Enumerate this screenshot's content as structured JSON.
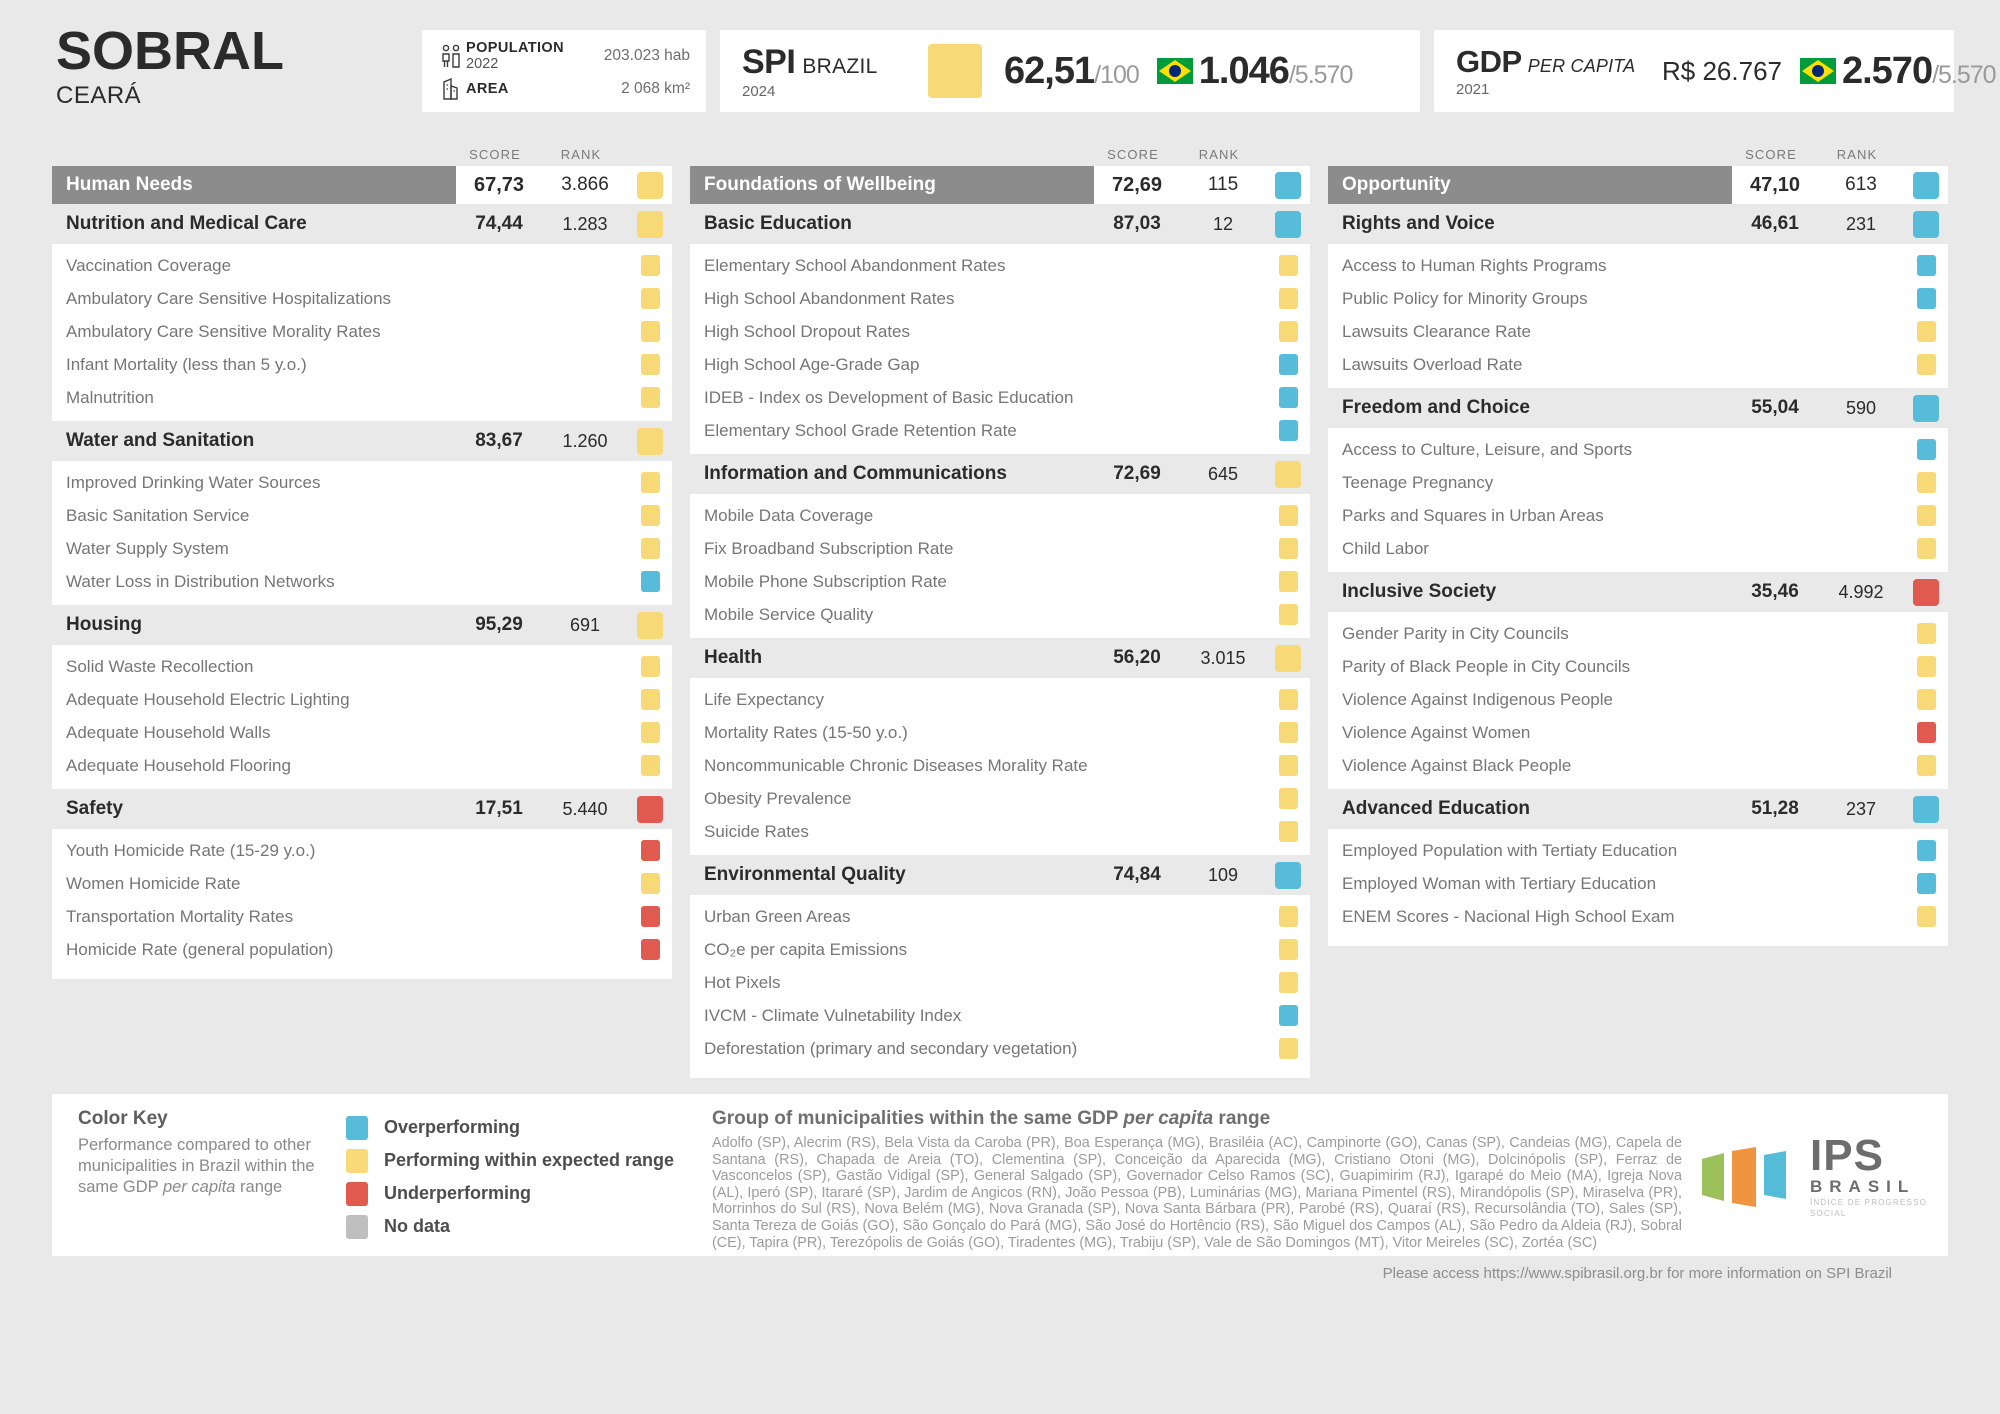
{
  "header": {
    "city": "SOBRAL",
    "state": "CEARÁ",
    "population": {
      "label": "POPULATION",
      "year": "2022",
      "value": "203.023 hab",
      "icon": "people-icon"
    },
    "area": {
      "label": "AREA",
      "value": "2 068 km²",
      "icon": "building-icon"
    },
    "spi": {
      "title": "SPI",
      "country": "BRAZIL",
      "year": "2024",
      "swatch_color": "#f8d978",
      "score": "62,51",
      "score_denominator": "/100",
      "rank": "1.046",
      "rank_denominator": "/5.570",
      "flag": "brazil-flag-icon"
    },
    "gdp": {
      "title": "GDP",
      "subtitle": "PER CAPITA",
      "year": "2021",
      "value": "R$ 26.767",
      "rank": "2.570",
      "rank_denominator": "/5.570",
      "flag": "brazil-flag-icon"
    }
  },
  "table_headers": {
    "score": "SCORE",
    "rank": "RANK"
  },
  "colors": {
    "over": "#56bcd9",
    "within": "#f8d978",
    "under": "#e05a4f",
    "nodata": "#bfbfbf",
    "dimension_bar": "#8c8c8c"
  },
  "columns": [
    {
      "dimension": {
        "name": "Human Needs",
        "score": "67,73",
        "rank": "3.866",
        "status": "within"
      },
      "components": [
        {
          "name": "Nutrition and Medical Care",
          "score": "74,44",
          "rank": "1.283",
          "status": "within",
          "indicators": [
            {
              "name": "Vaccination Coverage",
              "status": "within"
            },
            {
              "name": "Ambulatory Care Sensitive Hospitalizations",
              "status": "within"
            },
            {
              "name": "Ambulatory Care Sensitive Morality Rates",
              "status": "within"
            },
            {
              "name": "Infant Mortality (less than 5 y.o.)",
              "status": "within"
            },
            {
              "name": "Malnutrition",
              "status": "within"
            }
          ]
        },
        {
          "name": "Water and Sanitation",
          "score": "83,67",
          "rank": "1.260",
          "status": "within",
          "indicators": [
            {
              "name": "Improved Drinking Water Sources",
              "status": "within"
            },
            {
              "name": "Basic Sanitation Service",
              "status": "within"
            },
            {
              "name": "Water Supply System",
              "status": "within"
            },
            {
              "name": "Water Loss in Distribution Networks",
              "status": "over"
            }
          ]
        },
        {
          "name": "Housing",
          "score": "95,29",
          "rank": "691",
          "status": "within",
          "indicators": [
            {
              "name": "Solid Waste Recollection",
              "status": "within"
            },
            {
              "name": "Adequate Household Electric Lighting",
              "status": "within"
            },
            {
              "name": "Adequate Household Walls",
              "status": "within"
            },
            {
              "name": "Adequate Household Flooring",
              "status": "within"
            }
          ]
        },
        {
          "name": "Safety",
          "score": "17,51",
          "rank": "5.440",
          "status": "under",
          "indicators": [
            {
              "name": "Youth Homicide Rate (15-29 y.o.)",
              "status": "under"
            },
            {
              "name": "Women Homicide Rate",
              "status": "within"
            },
            {
              "name": "Transportation Mortality Rates",
              "status": "under"
            },
            {
              "name": "Homicide Rate (general population)",
              "status": "under"
            }
          ]
        }
      ]
    },
    {
      "dimension": {
        "name": "Foundations of Wellbeing",
        "score": "72,69",
        "rank": "115",
        "status": "over"
      },
      "components": [
        {
          "name": "Basic Education",
          "score": "87,03",
          "rank": "12",
          "status": "over",
          "indicators": [
            {
              "name": "Elementary School Abandonment Rates",
              "status": "within"
            },
            {
              "name": "High School Abandonment Rates",
              "status": "within"
            },
            {
              "name": "High School Dropout Rates",
              "status": "within"
            },
            {
              "name": "High School Age-Grade Gap",
              "status": "over"
            },
            {
              "name": "IDEB - Index os Development of Basic Education",
              "status": "over"
            },
            {
              "name": "Elementary School Grade Retention Rate",
              "status": "over"
            }
          ]
        },
        {
          "name": "Information and Communications",
          "score": "72,69",
          "rank": "645",
          "status": "within",
          "indicators": [
            {
              "name": "Mobile Data Coverage",
              "status": "within"
            },
            {
              "name": "Fix Broadband Subscription Rate",
              "status": "within"
            },
            {
              "name": "Mobile Phone Subscription Rate",
              "status": "within"
            },
            {
              "name": "Mobile Service Quality",
              "status": "within"
            }
          ]
        },
        {
          "name": "Health",
          "score": "56,20",
          "rank": "3.015",
          "status": "within",
          "indicators": [
            {
              "name": "Life Expectancy",
              "status": "within"
            },
            {
              "name": "Mortality Rates (15-50 y.o.)",
              "status": "within"
            },
            {
              "name": "Noncommunicable Chronic Diseases Morality Rate",
              "status": "within"
            },
            {
              "name": "Obesity Prevalence",
              "status": "within"
            },
            {
              "name": "Suicide Rates",
              "status": "within"
            }
          ]
        },
        {
          "name": "Environmental Quality",
          "score": "74,84",
          "rank": "109",
          "status": "over",
          "indicators": [
            {
              "name": "Urban Green Areas",
              "status": "within"
            },
            {
              "name": "CO₂e per capita Emissions",
              "status": "within"
            },
            {
              "name": "Hot Pixels",
              "status": "within"
            },
            {
              "name": "IVCM - Climate Vulnetability Index",
              "status": "over"
            },
            {
              "name": "Deforestation (primary and secondary vegetation)",
              "status": "within"
            }
          ]
        }
      ]
    },
    {
      "dimension": {
        "name": "Opportunity",
        "score": "47,10",
        "rank": "613",
        "status": "over"
      },
      "components": [
        {
          "name": "Rights and Voice",
          "score": "46,61",
          "rank": "231",
          "status": "over",
          "indicators": [
            {
              "name": "Access to Human Rights Programs",
              "status": "over"
            },
            {
              "name": "Public Policy for Minority Groups",
              "status": "over"
            },
            {
              "name": "Lawsuits Clearance Rate",
              "status": "within"
            },
            {
              "name": "Lawsuits Overload Rate",
              "status": "within"
            }
          ]
        },
        {
          "name": "Freedom and Choice",
          "score": "55,04",
          "rank": "590",
          "status": "over",
          "indicators": [
            {
              "name": "Access to Culture, Leisure, and Sports",
              "status": "over"
            },
            {
              "name": "Teenage Pregnancy",
              "status": "within"
            },
            {
              "name": "Parks and Squares in Urban Areas",
              "status": "within"
            },
            {
              "name": "Child Labor",
              "status": "within"
            }
          ]
        },
        {
          "name": "Inclusive Society",
          "score": "35,46",
          "rank": "4.992",
          "status": "under",
          "indicators": [
            {
              "name": "Gender Parity in City Councils",
              "status": "within"
            },
            {
              "name": "Parity of Black People in City Councils",
              "status": "within"
            },
            {
              "name": "Violence Against Indigenous People",
              "status": "within"
            },
            {
              "name": "Violence Against Women",
              "status": "under"
            },
            {
              "name": "Violence Against Black People",
              "status": "within"
            }
          ]
        },
        {
          "name": "Advanced Education",
          "score": "51,28",
          "rank": "237",
          "status": "over",
          "indicators": [
            {
              "name": "Employed Population with Tertiaty Education",
              "status": "over"
            },
            {
              "name": "Employed Woman with Tertiary Education",
              "status": "over"
            },
            {
              "name": "ENEM Scores - Nacional High School Exam",
              "status": "within"
            }
          ]
        }
      ]
    }
  ],
  "footer": {
    "key_title": "Color Key",
    "key_desc_1": "Performance compared to other municipalities in Brazil within the same GDP ",
    "key_desc_italic": "per capita",
    "key_desc_2": " range",
    "legend": [
      {
        "label": "Overperforming",
        "status": "over"
      },
      {
        "label": "Performing within expected range",
        "status": "within"
      },
      {
        "label": "Underperforming",
        "status": "under"
      },
      {
        "label": "No data",
        "status": "nodata"
      }
    ],
    "muni_title_1": "Group of municipalities within the same GDP ",
    "muni_title_italic": "per capita",
    "muni_title_2": " range",
    "muni_text": "Adolfo (SP), Alecrim (RS), Bela Vista da Caroba (PR), Boa Esperança (MG), Brasiléia (AC), Campinorte (GO), Canas (SP), Candeias (MG), Capela de Santana (RS), Chapada de Areia (TO), Clementina (SP), Conceição da Aparecida (MG), Cristiano Otoni (MG), Dolcinópolis (SP), Ferraz de Vasconcelos (SP), Gastão Vidigal (SP), General Salgado (SP), Governador Celso Ramos (SC), Guapimirim (RJ), Igarapé do Meio (MA), Igreja Nova (AL), Iperó (SP), Itararé (SP), Jardim de Angicos (RN), João Pessoa (PB), Luminárias (MG), Mariana Pimentel (RS), Mirandópolis (SP), Miraselva (PR), Morrinhos do Sul (RS), Nova Belém (MG), Nova Granada (SP), Nova Santa Bárbara (PR), Parobé (RS), Quaraí (RS), Recursolândia (TO), Sales (SP), Santa Tereza de Goiás (GO), São Gonçalo do Pará (MG), São José do Hortêncio (RS), São Miguel dos Campos (AL), São Pedro da Aldeia (RJ), Sobral (CE), Tapira (PR), Terezópolis de Goiás (GO), Tiradentes (MG), Trabiju (SP), Vale de São Domingos (MT), Vitor Meireles (SC), Zortéa (SC)",
    "logo": {
      "ips": "IPS",
      "brasil": "BRASIL",
      "tagline": "ÍNDICE DE PROGRESSO SOCIAL"
    },
    "bottom_note": "Please access https://www.spibrasil.org.br for more information on SPI Brazil"
  }
}
